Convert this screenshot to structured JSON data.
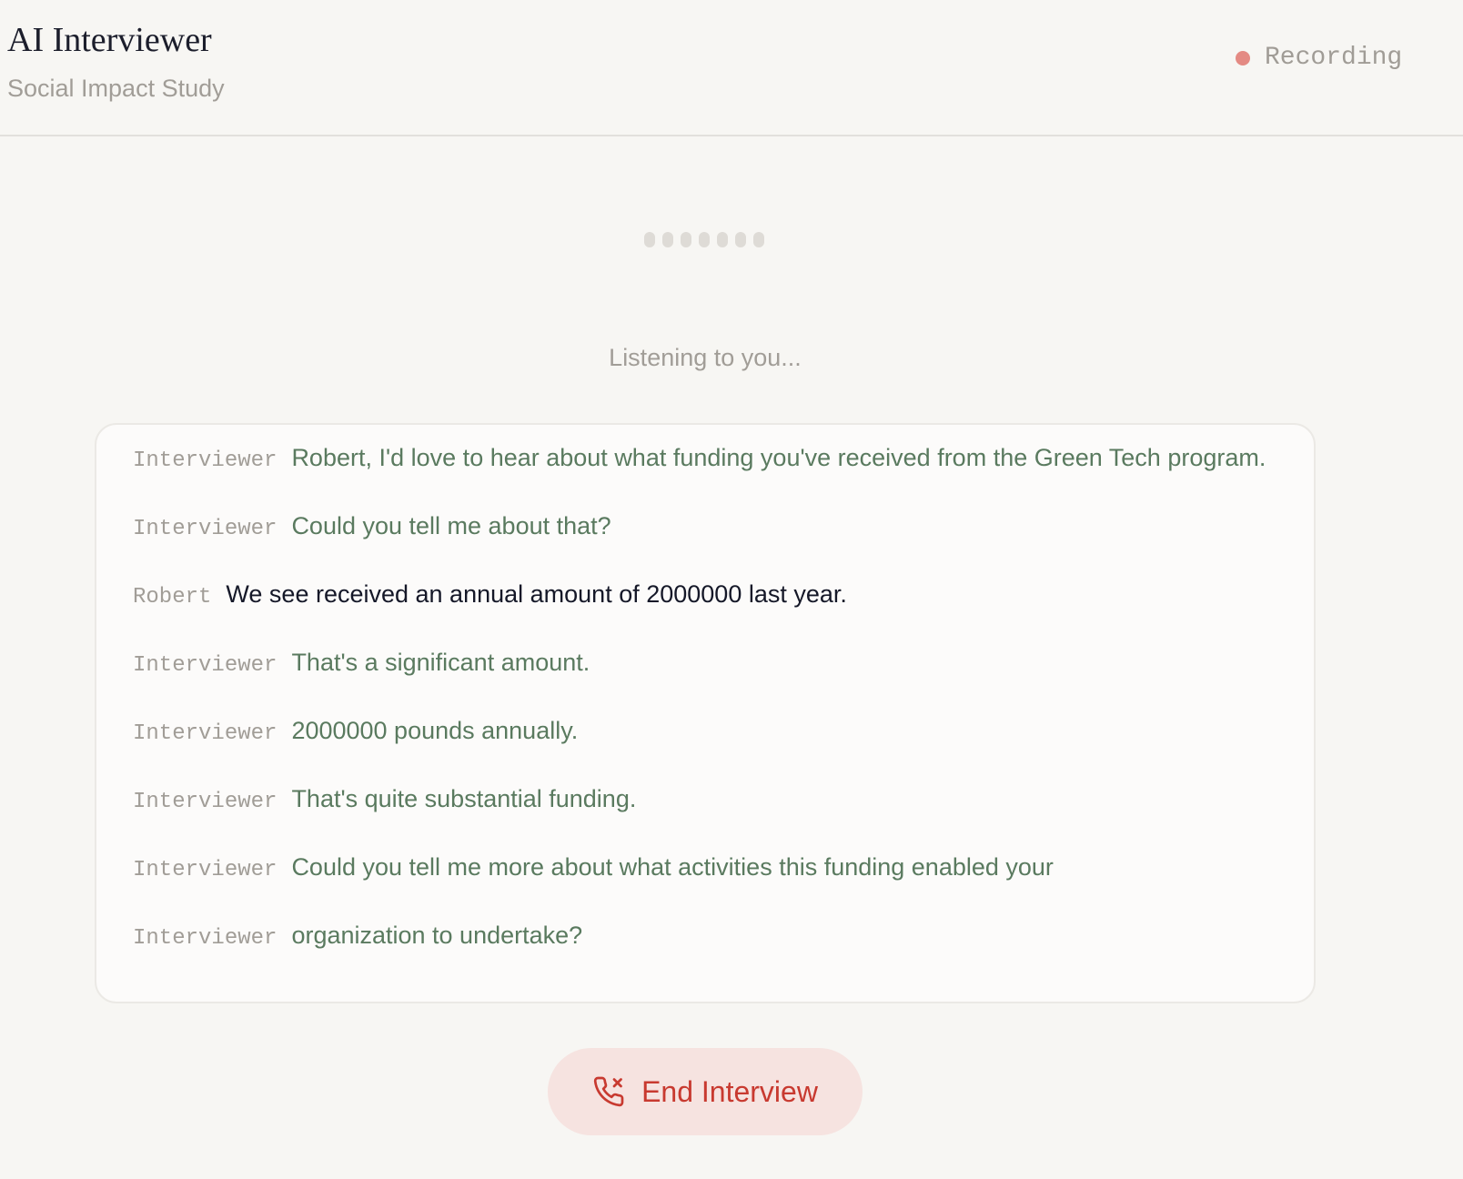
{
  "header": {
    "title": "AI Interviewer",
    "subtitle": "Social Impact Study",
    "recording_label": "Recording"
  },
  "status_text": "Listening to you...",
  "transcript": [
    {
      "speaker": "Interviewer",
      "text": "Robert, I'd love to hear about what funding you've received from the Green Tech program."
    },
    {
      "speaker": "Interviewer",
      "text": "Could you tell me about that?"
    },
    {
      "speaker": "Robert",
      "text": "We see received an annual amount of 2000000 last year."
    },
    {
      "speaker": "Interviewer",
      "text": "That's a significant amount."
    },
    {
      "speaker": "Interviewer",
      "text": "2000000 pounds annually."
    },
    {
      "speaker": "Interviewer",
      "text": "That's quite substantial funding."
    },
    {
      "speaker": "Interviewer",
      "text": "Could you tell me more about what activities this funding enabled your"
    },
    {
      "speaker": "Interviewer",
      "text": "organization to undertake?"
    }
  ],
  "end_button": {
    "label": "End Interview",
    "icon": "phone-end-icon"
  },
  "colors": {
    "background": "#f7f6f3",
    "interviewer_text": "#5a7a5f",
    "user_text": "#151828",
    "recording_dot": "#e48a83",
    "end_button_bg": "#f6e3e0",
    "end_button_text": "#c83a30"
  }
}
